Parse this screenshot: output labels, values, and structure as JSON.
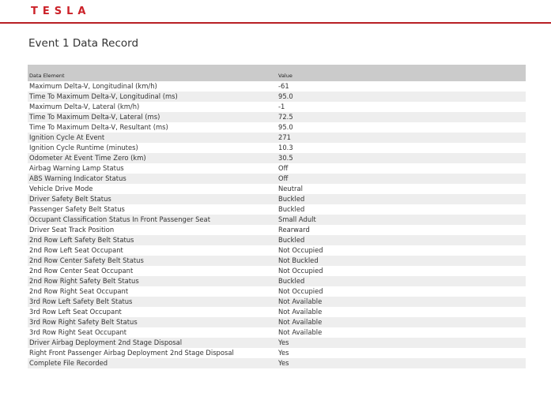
{
  "brand": {
    "logo_text": "TESLA",
    "accent_color": "#cc2229"
  },
  "page": {
    "title": "Event 1 Data Record"
  },
  "table": {
    "columns": [
      "Data Element",
      "Value"
    ],
    "rows": [
      {
        "element": "Maximum Delta-V, Longitudinal (km/h)",
        "value": "-61"
      },
      {
        "element": "Time To Maximum Delta-V, Longitudinal (ms)",
        "value": "95.0"
      },
      {
        "element": "Maximum Delta-V, Lateral (km/h)",
        "value": "-1"
      },
      {
        "element": "Time To Maximum Delta-V, Lateral (ms)",
        "value": "72.5"
      },
      {
        "element": "Time To Maximum Delta-V, Resultant (ms)",
        "value": "95.0"
      },
      {
        "element": "Ignition Cycle At Event",
        "value": "271"
      },
      {
        "element": "Ignition Cycle Runtime (minutes)",
        "value": "10.3"
      },
      {
        "element": "Odometer At Event Time Zero (km)",
        "value": "30.5"
      },
      {
        "element": "Airbag Warning Lamp Status",
        "value": "Off"
      },
      {
        "element": "ABS Warning Indicator Status",
        "value": "Off"
      },
      {
        "element": "Vehicle Drive Mode",
        "value": "Neutral"
      },
      {
        "element": "Driver Safety Belt Status",
        "value": "Buckled"
      },
      {
        "element": "Passenger Safety Belt Status",
        "value": "Buckled"
      },
      {
        "element": "Occupant Classification Status In Front Passenger Seat",
        "value": "Small Adult"
      },
      {
        "element": "Driver Seat Track Position",
        "value": "Rearward"
      },
      {
        "element": "2nd Row Left Safety Belt Status",
        "value": "Buckled"
      },
      {
        "element": "2nd Row Left Seat Occupant",
        "value": "Not Occupied"
      },
      {
        "element": "2nd Row Center Safety Belt Status",
        "value": "Not Buckled"
      },
      {
        "element": "2nd Row Center Seat Occupant",
        "value": "Not Occupied"
      },
      {
        "element": "2nd Row Right Safety Belt Status",
        "value": "Buckled"
      },
      {
        "element": "2nd Row Right Seat Occupant",
        "value": "Not Occupied"
      },
      {
        "element": "3rd Row Left Safety Belt Status",
        "value": "Not Available"
      },
      {
        "element": "3rd Row Left Seat Occupant",
        "value": "Not Available"
      },
      {
        "element": "3rd Row Right Safety Belt Status",
        "value": "Not Available"
      },
      {
        "element": "3rd Row Right Seat Occupant",
        "value": "Not Available"
      },
      {
        "element": "Driver Airbag Deployment 2nd Stage Disposal",
        "value": "Yes"
      },
      {
        "element": "Right Front Passenger Airbag Deployment 2nd Stage Disposal",
        "value": "Yes"
      },
      {
        "element": "Complete File Recorded",
        "value": "Yes"
      }
    ]
  }
}
